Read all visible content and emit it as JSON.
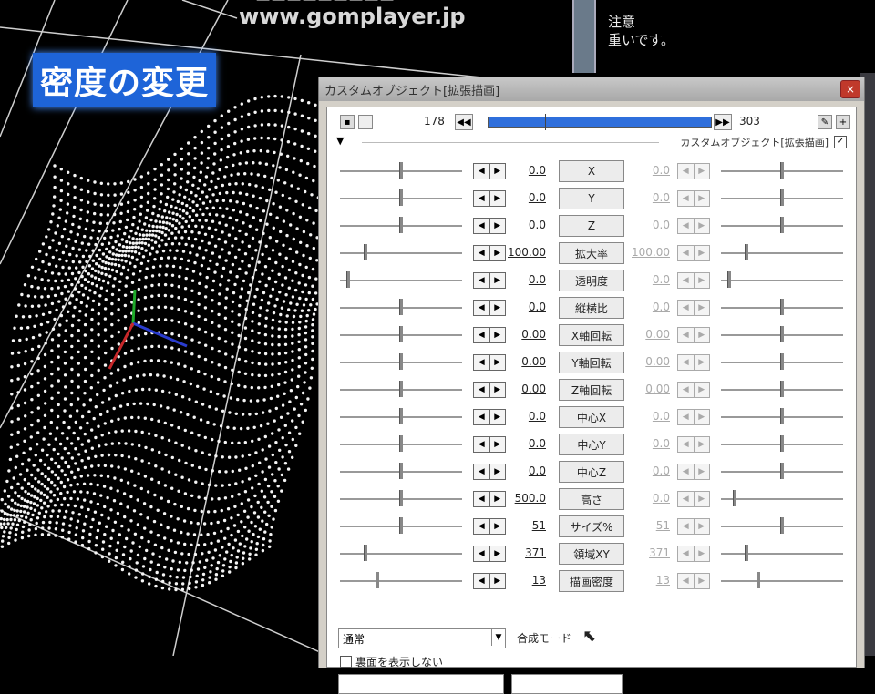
{
  "overlay": {
    "caption": "密度の変更",
    "watermark": "www.gomplayer.jp",
    "note_line1": "注意",
    "note_line2": "重いです。"
  },
  "window": {
    "title": "カスタムオブジェクト[拡張描画]",
    "close_label": "×",
    "frame_start": "178",
    "frame_end": "303",
    "prev_label": "◀◀",
    "next_label": "▶▶",
    "section_label": "カスタムオブジェクト[拡張描画]",
    "section_checked": "✓",
    "section_arrow": "▼",
    "blend_value": "通常",
    "blend_label": "合成モード",
    "backface_label": "裏面を表示しない"
  },
  "params": [
    {
      "label": "X",
      "left": "0.0",
      "right": "0.0",
      "lpos": 0.5,
      "rpos": 0.5
    },
    {
      "label": "Y",
      "left": "0.0",
      "right": "0.0",
      "lpos": 0.5,
      "rpos": 0.5
    },
    {
      "label": "Z",
      "left": "0.0",
      "right": "0.0",
      "lpos": 0.5,
      "rpos": 0.5
    },
    {
      "label": "拡大率",
      "left": "100.00",
      "right": "100.00",
      "lpos": 0.2,
      "rpos": 0.2
    },
    {
      "label": "透明度",
      "left": "0.0",
      "right": "0.0",
      "lpos": 0.05,
      "rpos": 0.05
    },
    {
      "label": "縦横比",
      "left": "0.0",
      "right": "0.0",
      "lpos": 0.5,
      "rpos": 0.5
    },
    {
      "label": "X軸回転",
      "left": "0.00",
      "right": "0.00",
      "lpos": 0.5,
      "rpos": 0.5
    },
    {
      "label": "Y軸回転",
      "left": "0.00",
      "right": "0.00",
      "lpos": 0.5,
      "rpos": 0.5
    },
    {
      "label": "Z軸回転",
      "left": "0.00",
      "right": "0.00",
      "lpos": 0.5,
      "rpos": 0.5
    },
    {
      "label": "中心X",
      "left": "0.0",
      "right": "0.0",
      "lpos": 0.5,
      "rpos": 0.5
    },
    {
      "label": "中心Y",
      "left": "0.0",
      "right": "0.0",
      "lpos": 0.5,
      "rpos": 0.5
    },
    {
      "label": "中心Z",
      "left": "0.0",
      "right": "0.0",
      "lpos": 0.5,
      "rpos": 0.5
    },
    {
      "label": "高さ",
      "left": "500.0",
      "right": "0.0",
      "lpos": 0.5,
      "rpos": 0.1
    },
    {
      "label": "サイズ%",
      "left": "51",
      "right": "51",
      "lpos": 0.5,
      "rpos": 0.5
    },
    {
      "label": "領域XY",
      "left": "371",
      "right": "371",
      "lpos": 0.2,
      "rpos": 0.2
    },
    {
      "label": "描画密度",
      "left": "13",
      "right": "13",
      "lpos": 0.3,
      "rpos": 0.3
    }
  ]
}
